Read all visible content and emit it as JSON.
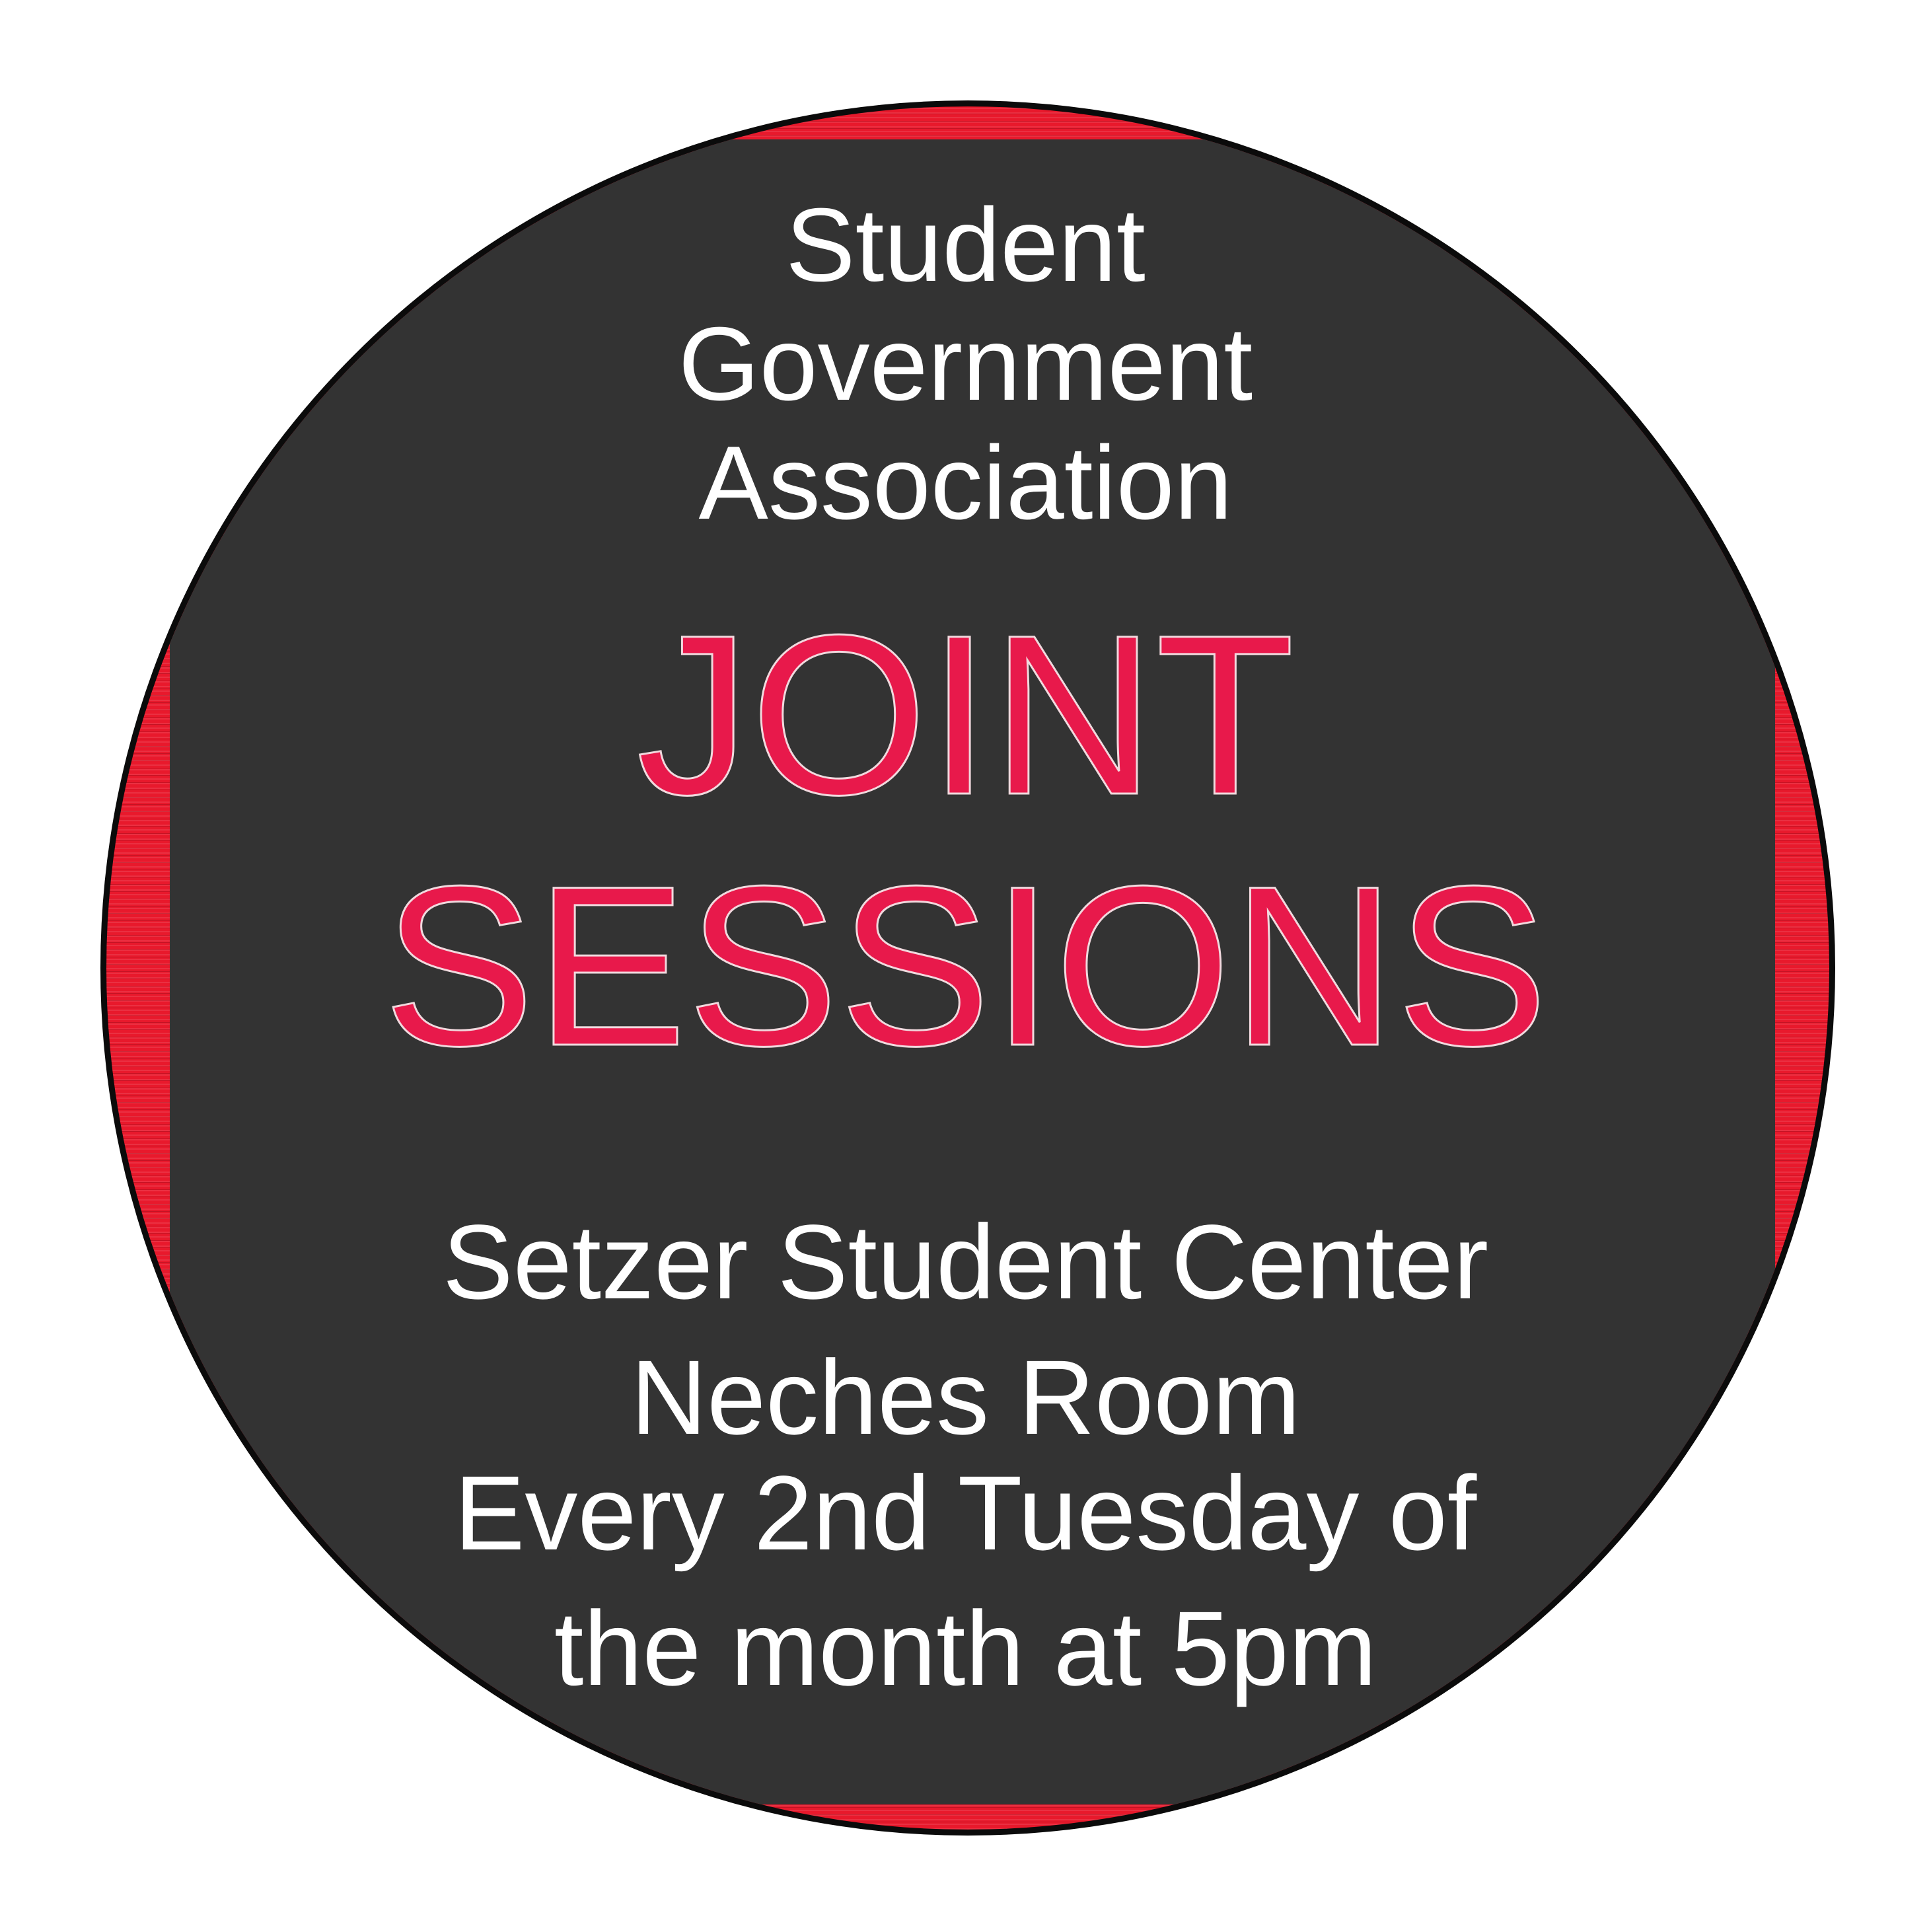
{
  "badge": {
    "header_lines": [
      "Student",
      "Government",
      "Association"
    ],
    "title_lines": [
      "JOINT",
      "SESSIONS"
    ],
    "info_lines": [
      "Setzer Student Center",
      "Neches Room",
      "Every 2nd Tuesday of",
      "the month at 5pm"
    ]
  },
  "colors": {
    "background": "#ffffff",
    "ring_red": "#e8192c",
    "panel_dark": "#333333",
    "title_pink_red": "#e8194b",
    "text_white": "#ffffff",
    "outline_black": "#0b0b0b"
  }
}
